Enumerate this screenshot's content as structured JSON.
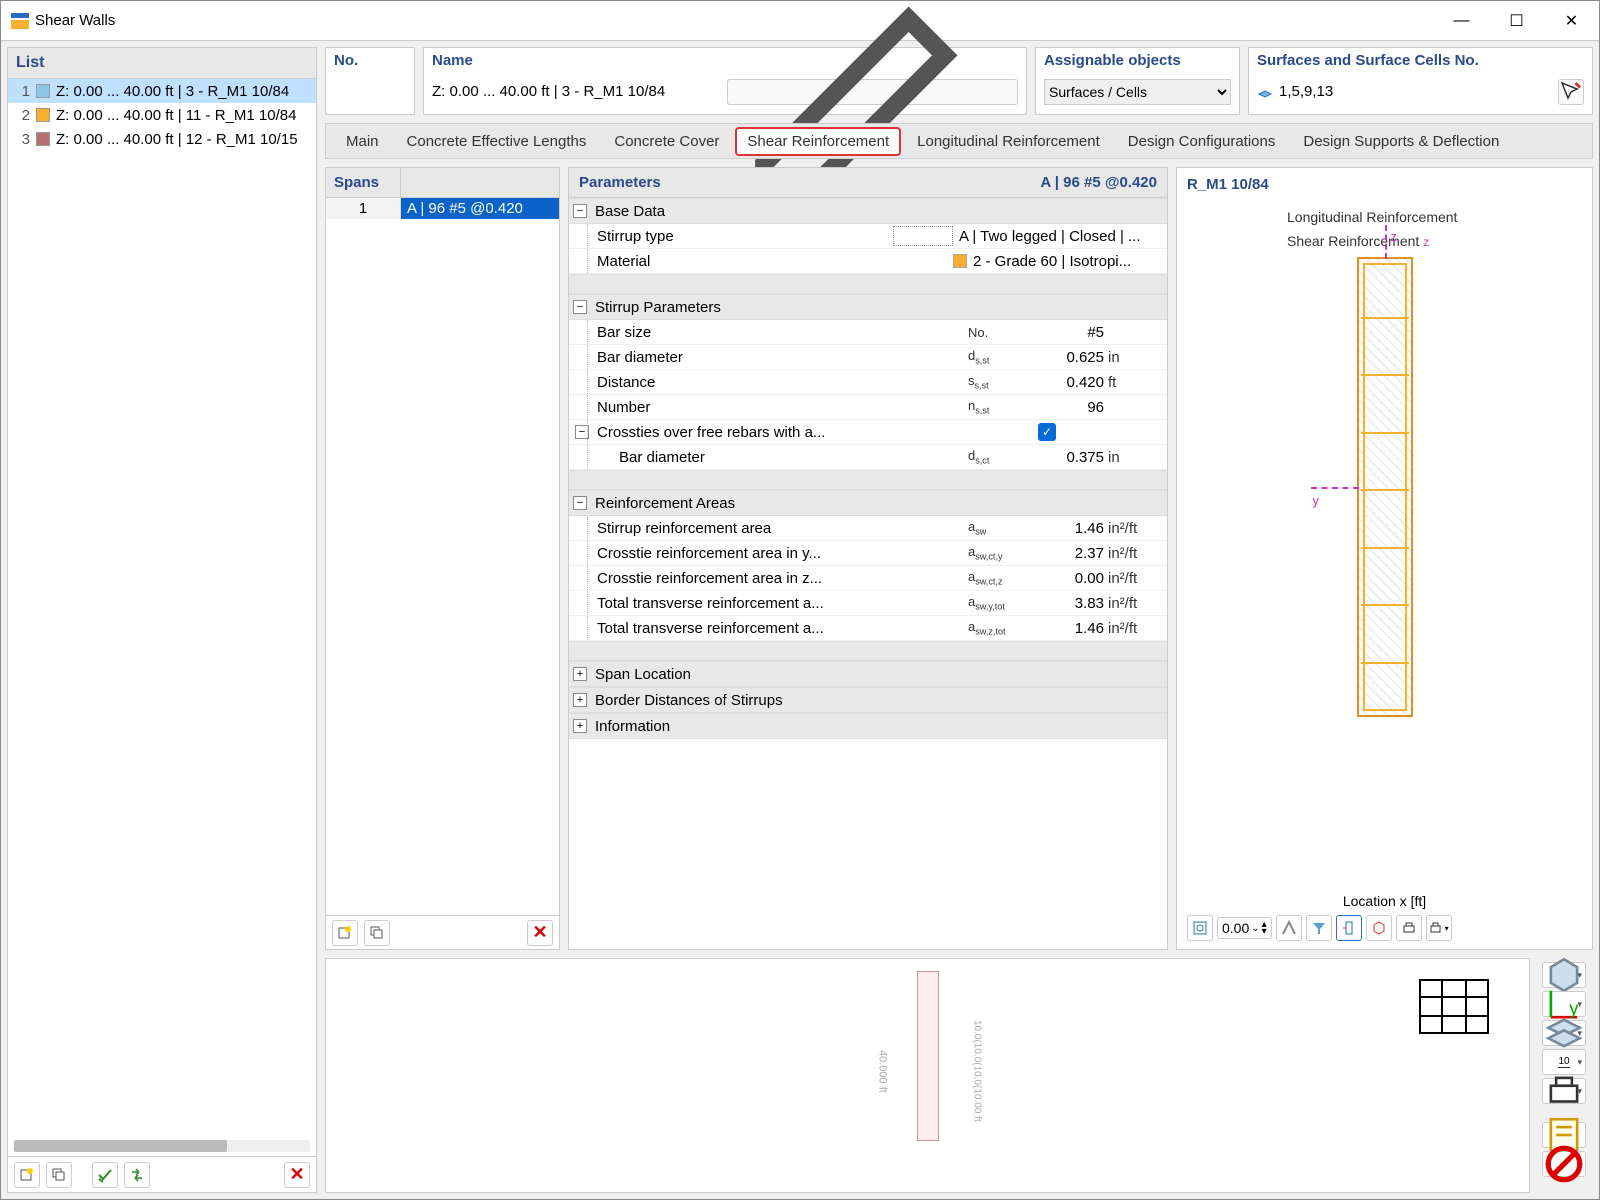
{
  "window": {
    "title": "Shear Walls"
  },
  "list": {
    "header": "List",
    "rows": [
      {
        "idx": "1",
        "color": "#8ec6e6",
        "text": "Z: 0.00 ... 40.00 ft | 3 - R_M1 10/84",
        "selected": true
      },
      {
        "idx": "2",
        "color": "#f5b02e",
        "text": "Z: 0.00 ... 40.00 ft | 11 - R_M1 10/84",
        "selected": false
      },
      {
        "idx": "3",
        "color": "#b57070",
        "text": "Z: 0.00 ... 40.00 ft | 12 - R_M1 10/15",
        "selected": false
      }
    ]
  },
  "top": {
    "no_label": "No.",
    "no_value": "",
    "name_label": "Name",
    "name_value": "Z: 0.00 ... 40.00  ft | 3 - R_M1 10/84",
    "assign_label": "Assignable objects",
    "assign_value": "Surfaces / Cells",
    "surf_label": "Surfaces and Surface Cells No.",
    "surf_value": "1,5,9,13"
  },
  "tabs": {
    "items": [
      "Main",
      "Concrete Effective Lengths",
      "Concrete Cover",
      "Shear Reinforcement",
      "Longitudinal Reinforcement",
      "Design Configurations",
      "Design Supports & Deflection"
    ],
    "active": "Shear Reinforcement"
  },
  "spans": {
    "header": "Spans",
    "rows": [
      {
        "n": "1",
        "label": "A | 96 #5 @0.420"
      }
    ]
  },
  "params": {
    "header": "Parameters",
    "header_right": "A | 96 #5 @0.420",
    "groups": {
      "base": {
        "title": "Base Data",
        "stirrup_type_label": "Stirrup type",
        "stirrup_type_value": "A | Two legged | Closed | ...",
        "material_label": "Material",
        "material_value": "2 - Grade 60 | Isotropi..."
      },
      "stirrup": {
        "title": "Stirrup Parameters",
        "bar_size_label": "Bar size",
        "bar_size_sym": "No.",
        "bar_size_val": "#5",
        "bar_dia_label": "Bar diameter",
        "bar_dia_sym": "d",
        "bar_dia_sub": "s,st",
        "bar_dia_val": "0.625",
        "bar_dia_unit": "in",
        "dist_label": "Distance",
        "dist_sym": "s",
        "dist_sub": "s,st",
        "dist_val": "0.420",
        "dist_unit": "ft",
        "num_label": "Number",
        "num_sym": "n",
        "num_sub": "s,st",
        "num_val": "96",
        "cross_label": "Crossties over free rebars with a...",
        "cross_dia_label": "Bar diameter",
        "cross_dia_sym": "d",
        "cross_dia_sub": "s,ct",
        "cross_dia_val": "0.375",
        "cross_dia_unit": "in"
      },
      "areas": {
        "title": "Reinforcement Areas",
        "r1_label": "Stirrup reinforcement area",
        "r1_sym": "a",
        "r1_sub": "sw",
        "r1_val": "1.46",
        "r1_unit": "in²/ft",
        "r2_label": "Crosstie reinforcement area in y...",
        "r2_sym": "a",
        "r2_sub": "sw,ct,y",
        "r2_val": "2.37",
        "r2_unit": "in²/ft",
        "r3_label": "Crosstie reinforcement area in z...",
        "r3_sym": "a",
        "r3_sub": "sw,ct,z",
        "r3_val": "0.00",
        "r3_unit": "in²/ft",
        "r4_label": "Total transverse reinforcement a...",
        "r4_sym": "a",
        "r4_sub": "sw,y,tot",
        "r4_val": "3.83",
        "r4_unit": "in²/ft",
        "r5_label": "Total transverse reinforcement a...",
        "r5_sym": "a",
        "r5_sub": "sw,z,tot",
        "r5_val": "1.46",
        "r5_unit": "in²/ft"
      },
      "span_loc": "Span Location",
      "border": "Border Distances of Stirrups",
      "info": "Information"
    }
  },
  "preview": {
    "title": "R_M1 10/84",
    "legend1": "Longitudinal Reinforcement",
    "legend2": "Shear Reinforcement",
    "z": "z",
    "y": "y",
    "location_label": "Location x [ft]",
    "location_value": "0.00"
  },
  "bottom": {
    "elev_dim": "40.000 ft",
    "elev_ticks": "10.0(10.0(10.0(10.00 ft"
  }
}
